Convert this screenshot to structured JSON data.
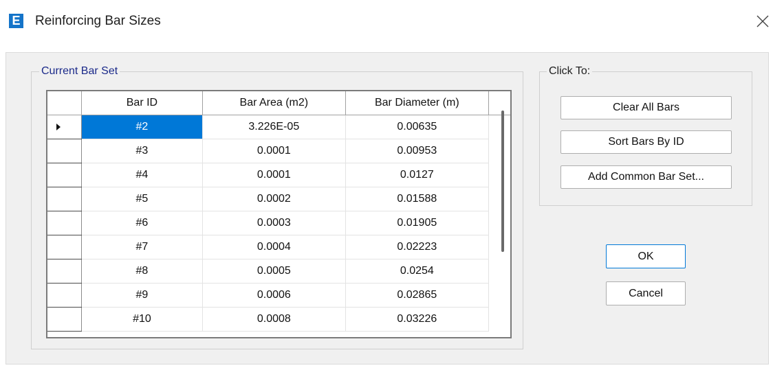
{
  "window": {
    "title": "Reinforcing Bar Sizes",
    "app_icon_letter": "E"
  },
  "current_bar_set": {
    "legend": "Current Bar Set",
    "columns": [
      "Bar ID",
      "Bar Area  (m2)",
      "Bar Diameter  (m)"
    ],
    "rows": [
      {
        "id": "#2",
        "area": "3.226E-05",
        "diameter": "0.00635"
      },
      {
        "id": "#3",
        "area": "0.0001",
        "diameter": "0.00953"
      },
      {
        "id": "#4",
        "area": "0.0001",
        "diameter": "0.0127"
      },
      {
        "id": "#5",
        "area": "0.0002",
        "diameter": "0.01588"
      },
      {
        "id": "#6",
        "area": "0.0003",
        "diameter": "0.01905"
      },
      {
        "id": "#7",
        "area": "0.0004",
        "diameter": "0.02223"
      },
      {
        "id": "#8",
        "area": "0.0005",
        "diameter": "0.0254"
      },
      {
        "id": "#9",
        "area": "0.0006",
        "diameter": "0.02865"
      },
      {
        "id": "#10",
        "area": "0.0008",
        "diameter": "0.03226"
      }
    ],
    "selected_row": 0
  },
  "click_to": {
    "legend": "Click To:",
    "clear_all_bars": "Clear All Bars",
    "sort_bars_by_id": "Sort Bars By ID",
    "add_common_bar_set": "Add Common Bar Set..."
  },
  "buttons": {
    "ok": "OK",
    "cancel": "Cancel"
  },
  "colors": {
    "selection": "#0078d7",
    "app_icon": "#1474c9",
    "group_legend": "#1b2a8a"
  }
}
